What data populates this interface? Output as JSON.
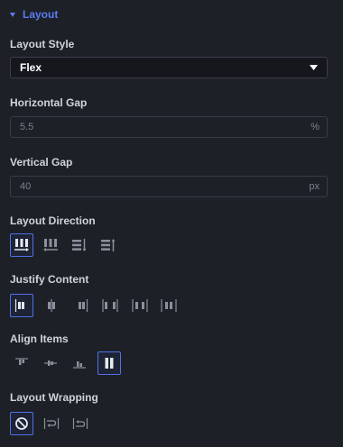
{
  "section": {
    "title": "Layout"
  },
  "layout_style": {
    "label": "Layout Style",
    "value": "Flex"
  },
  "horizontal_gap": {
    "label": "Horizontal Gap",
    "value": "5.5",
    "unit": "%"
  },
  "vertical_gap": {
    "label": "Vertical Gap",
    "value": "40",
    "unit": "px"
  },
  "layout_direction": {
    "label": "Layout Direction",
    "options": [
      "row",
      "row-reverse",
      "column",
      "column-reverse"
    ],
    "selected": "row"
  },
  "justify_content": {
    "label": "Justify Content",
    "options": [
      "flex-start",
      "center",
      "flex-end",
      "space-between",
      "space-around",
      "space-evenly"
    ],
    "selected": "flex-start"
  },
  "align_items": {
    "label": "Align Items",
    "options": [
      "flex-start",
      "center",
      "flex-end",
      "stretch"
    ],
    "selected": "stretch"
  },
  "layout_wrapping": {
    "label": "Layout Wrapping",
    "options": [
      "nowrap",
      "wrap",
      "wrap-reverse"
    ],
    "selected": "nowrap"
  },
  "colors": {
    "accent": "#4f72e8",
    "icon": "#8a909c",
    "icon_active": "#e6e9f0",
    "background": "#1d2027"
  }
}
